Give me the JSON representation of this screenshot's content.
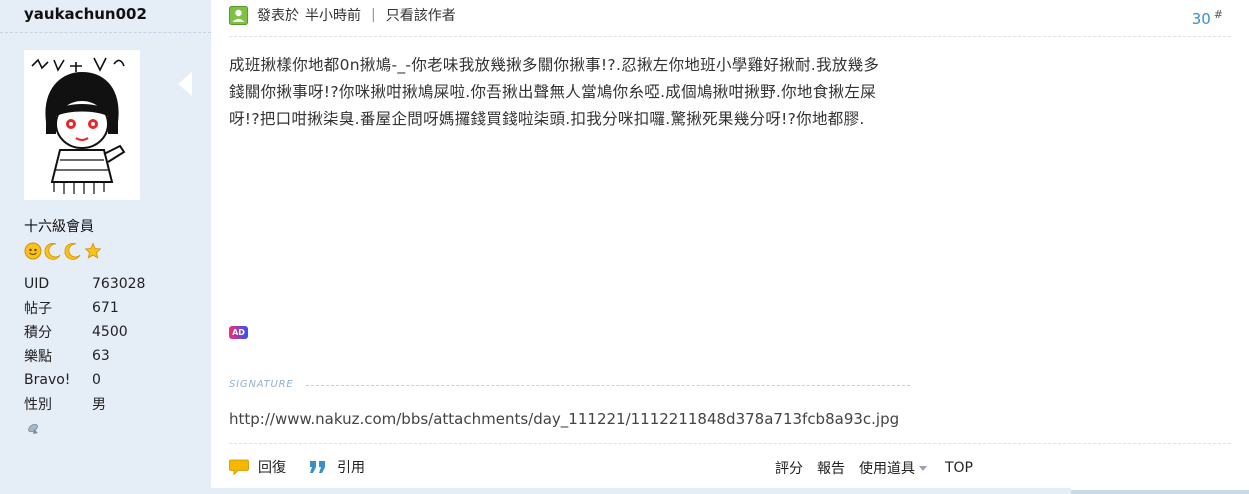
{
  "author": {
    "username": "yaukachun002",
    "rank_title": "十六級會員",
    "rank_icons": [
      "sun-icon",
      "moon-icon",
      "moon-icon",
      "star-icon"
    ],
    "stats": [
      {
        "key": "UID",
        "value": "763028"
      },
      {
        "key": "帖子",
        "value": "671"
      },
      {
        "key": "積分",
        "value": "4500"
      },
      {
        "key": "樂點",
        "value": "63"
      },
      {
        "key": "Bravo!",
        "value": "0"
      },
      {
        "key": "性別",
        "value": "男"
      }
    ]
  },
  "post": {
    "posted_label": "發表於",
    "posted_time": "半小時前",
    "divider": "|",
    "author_only_link": "只看該作者",
    "floor_number": "30",
    "floor_symbol": "#",
    "body_lines": [
      "成班揪樣你地都0n揪鳩-_-你老味我放幾揪多關你揪事!?.忍揪左你地班小學雞好揪耐.我放幾多",
      "錢關你揪事呀!?你咪揪咁揪鳩屎啦.你吾揪出聲無人當鳩你糸啞.成個鳩揪咁揪野.你地食揪左屎",
      "呀!?把口咁揪柒臭.番屋企問呀媽攞錢買錢啦柒頭.扣我分咪扣囉.驚揪死果幾分呀!?你地都膠."
    ],
    "ad_badge": "AD",
    "signature_label": "SIGNATURE",
    "signature_text": "http://www.nakuz.com/bbs/attachments/day_111221/1112211848d378a713fcb8a93c.jpg"
  },
  "footer": {
    "reply_label": "回復",
    "quote_label": "引用",
    "rate_label": "評分",
    "report_label": "報告",
    "tools_label": "使用道具",
    "top_label": "TOP"
  },
  "colors": {
    "sidebar_bg": "#e5edf7",
    "floor_color": "#3a8fc9",
    "signature_color": "#8fb1cf"
  }
}
